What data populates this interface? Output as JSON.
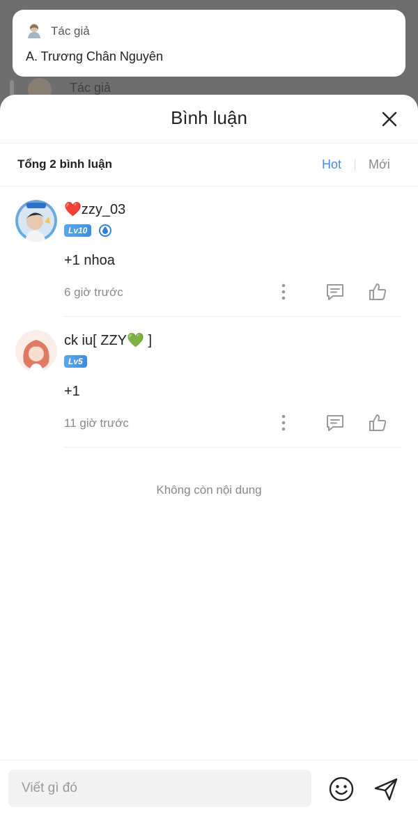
{
  "background": {
    "author_label": "Tác giả",
    "author_name": "A. Trương Chân Nguyên",
    "behind_label": "Tác giả"
  },
  "sheet": {
    "title": "Bình luận",
    "total": "Tổng 2 bình luận",
    "sort_hot": "Hot",
    "sort_new": "Mới"
  },
  "comments": [
    {
      "name_heart": "❤️",
      "name": "zzy_03",
      "level": "Lv10",
      "text": "+1 nhoa",
      "time": "6 giờ trước"
    },
    {
      "name_prefix": "ck iu[ ZZY",
      "name_heart": "💚",
      "name_suffix": " ]",
      "level": "Lv5",
      "text": "+1",
      "time": "11 giờ trước"
    }
  ],
  "end_text": "Không còn nội dung",
  "footer": {
    "placeholder": "Viết gì đó"
  },
  "colors": {
    "accent": "#4a90d9",
    "level_badge": "#4a9be8",
    "muted": "#8a8a8a"
  }
}
